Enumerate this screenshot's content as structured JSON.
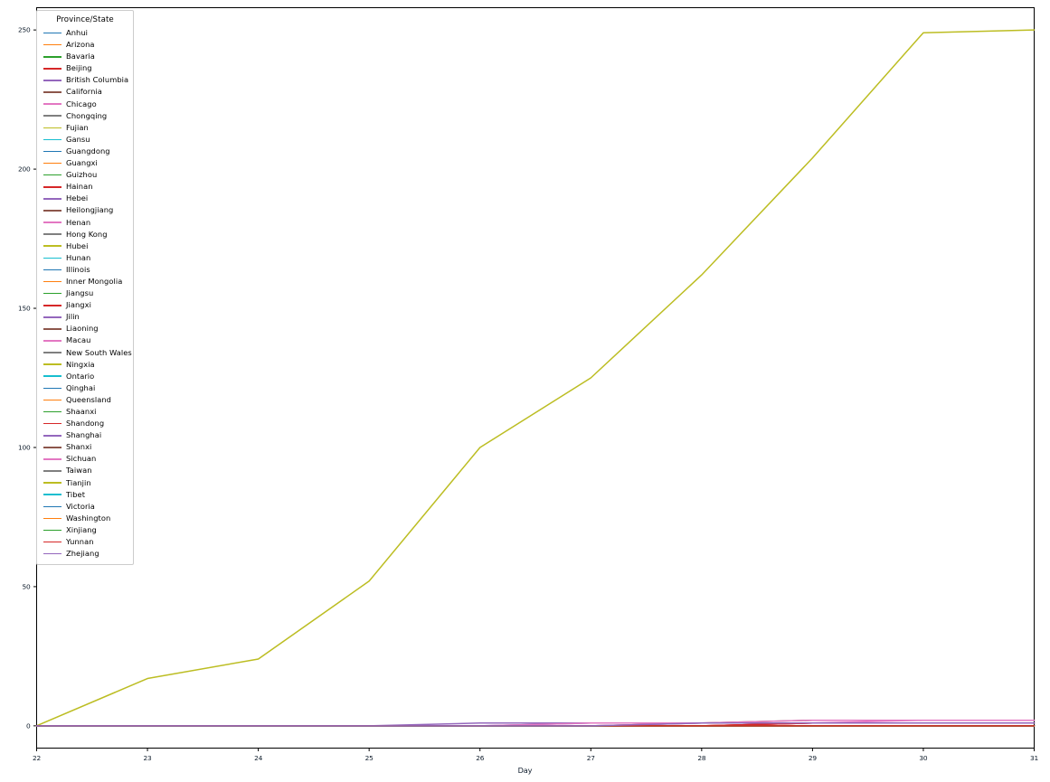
{
  "chart_data": {
    "type": "line",
    "title": "",
    "xlabel": "Day",
    "ylabel": "",
    "legend_title": "Province/State",
    "legend_position": "upper-left-inside",
    "grid": false,
    "x": [
      22,
      23,
      24,
      25,
      26,
      27,
      28,
      29,
      30,
      31
    ],
    "xticks": [
      "22",
      "23",
      "24",
      "25",
      "26",
      "27",
      "28",
      "29",
      "30",
      "31"
    ],
    "yticks": [
      "0",
      "50",
      "100",
      "150",
      "200",
      "250"
    ],
    "xlim": [
      22,
      31
    ],
    "ylim": [
      -8,
      258
    ],
    "series": [
      {
        "name": "Anhui",
        "color": "#1f77b4",
        "values": [
          0,
          0,
          0,
          0,
          0,
          0,
          0,
          0,
          0,
          0
        ]
      },
      {
        "name": "Arizona",
        "color": "#ff7f0e",
        "values": [
          0,
          0,
          0,
          0,
          0,
          0,
          0,
          0,
          0,
          0
        ]
      },
      {
        "name": "Bavaria",
        "color": "#2ca02c",
        "values": [
          0,
          0,
          0,
          0,
          0,
          0,
          0,
          0,
          0,
          0
        ]
      },
      {
        "name": "Beijing",
        "color": "#d62728",
        "values": [
          0,
          0,
          0,
          0,
          0,
          0,
          0,
          1,
          1,
          1
        ]
      },
      {
        "name": "British Columbia",
        "color": "#9467bd",
        "values": [
          0,
          0,
          0,
          0,
          0,
          0,
          0,
          0,
          0,
          0
        ]
      },
      {
        "name": "California",
        "color": "#8c564b",
        "values": [
          0,
          0,
          0,
          0,
          0,
          0,
          0,
          0,
          0,
          0
        ]
      },
      {
        "name": "Chicago",
        "color": "#e377c2",
        "values": [
          0,
          0,
          0,
          0,
          0,
          0,
          0,
          0,
          0,
          0
        ]
      },
      {
        "name": "Chongqing",
        "color": "#7f7f7f",
        "values": [
          0,
          0,
          0,
          0,
          0,
          0,
          0,
          0,
          0,
          0
        ]
      },
      {
        "name": "Fujian",
        "color": "#bcbd22",
        "values": [
          0,
          0,
          0,
          0,
          0,
          0,
          0,
          0,
          0,
          0
        ]
      },
      {
        "name": "Gansu",
        "color": "#17becf",
        "values": [
          0,
          0,
          0,
          0,
          0,
          0,
          0,
          0,
          0,
          0
        ]
      },
      {
        "name": "Guangdong",
        "color": "#1f77b4",
        "values": [
          0,
          0,
          0,
          0,
          0,
          0,
          0,
          0,
          0,
          0
        ]
      },
      {
        "name": "Guangxi",
        "color": "#ff7f0e",
        "values": [
          0,
          0,
          0,
          0,
          0,
          0,
          0,
          0,
          0,
          0
        ]
      },
      {
        "name": "Guizhou",
        "color": "#2ca02c",
        "values": [
          0,
          0,
          0,
          0,
          0,
          0,
          0,
          0,
          0,
          0
        ]
      },
      {
        "name": "Hainan",
        "color": "#d62728",
        "values": [
          0,
          0,
          0,
          0,
          0,
          0,
          0,
          1,
          1,
          1
        ]
      },
      {
        "name": "Hebei",
        "color": "#9467bd",
        "values": [
          0,
          0,
          0,
          0,
          0,
          1,
          1,
          1,
          1,
          1
        ]
      },
      {
        "name": "Heilongjiang",
        "color": "#8c564b",
        "values": [
          0,
          0,
          0,
          0,
          0,
          0,
          1,
          2,
          2,
          2
        ]
      },
      {
        "name": "Henan",
        "color": "#e377c2",
        "values": [
          0,
          0,
          0,
          0,
          0,
          0,
          1,
          2,
          2,
          2
        ]
      },
      {
        "name": "Hong Kong",
        "color": "#7f7f7f",
        "values": [
          0,
          0,
          0,
          0,
          0,
          0,
          0,
          0,
          0,
          0
        ]
      },
      {
        "name": "Hubei",
        "color": "#bcbd22",
        "values": [
          0,
          17,
          24,
          52,
          100,
          125,
          162,
          204,
          249,
          250
        ]
      },
      {
        "name": "Hunan",
        "color": "#17becf",
        "values": [
          0,
          0,
          0,
          0,
          0,
          0,
          0,
          0,
          0,
          0
        ]
      },
      {
        "name": "Illinois",
        "color": "#1f77b4",
        "values": [
          0,
          0,
          0,
          0,
          0,
          0,
          0,
          0,
          0,
          0
        ]
      },
      {
        "name": "Inner Mongolia",
        "color": "#ff7f0e",
        "values": [
          0,
          0,
          0,
          0,
          0,
          0,
          0,
          0,
          0,
          0
        ]
      },
      {
        "name": "Jiangsu",
        "color": "#2ca02c",
        "values": [
          0,
          0,
          0,
          0,
          0,
          0,
          0,
          0,
          0,
          0
        ]
      },
      {
        "name": "Jiangxi",
        "color": "#d62728",
        "values": [
          0,
          0,
          0,
          0,
          0,
          0,
          0,
          0,
          0,
          0
        ]
      },
      {
        "name": "Jilin",
        "color": "#9467bd",
        "values": [
          0,
          0,
          0,
          0,
          0,
          0,
          0,
          0,
          0,
          0
        ]
      },
      {
        "name": "Liaoning",
        "color": "#8c564b",
        "values": [
          0,
          0,
          0,
          0,
          0,
          0,
          0,
          0,
          0,
          0
        ]
      },
      {
        "name": "Macau",
        "color": "#e377c2",
        "values": [
          0,
          0,
          0,
          0,
          0,
          0,
          0,
          0,
          0,
          0
        ]
      },
      {
        "name": "New South Wales",
        "color": "#7f7f7f",
        "values": [
          0,
          0,
          0,
          0,
          0,
          0,
          0,
          0,
          0,
          0
        ]
      },
      {
        "name": "Ningxia",
        "color": "#bcbd22",
        "values": [
          0,
          0,
          0,
          0,
          0,
          0,
          0,
          0,
          0,
          0
        ]
      },
      {
        "name": "Ontario",
        "color": "#17becf",
        "values": [
          0,
          0,
          0,
          0,
          0,
          0,
          0,
          0,
          0,
          0
        ]
      },
      {
        "name": "Qinghai",
        "color": "#1f77b4",
        "values": [
          0,
          0,
          0,
          0,
          0,
          0,
          0,
          0,
          0,
          0
        ]
      },
      {
        "name": "Queensland",
        "color": "#ff7f0e",
        "values": [
          0,
          0,
          0,
          0,
          0,
          0,
          0,
          0,
          0,
          0
        ]
      },
      {
        "name": "Shaanxi",
        "color": "#2ca02c",
        "values": [
          0,
          0,
          0,
          0,
          0,
          0,
          0,
          0,
          0,
          0
        ]
      },
      {
        "name": "Shandong",
        "color": "#d62728",
        "values": [
          0,
          0,
          0,
          0,
          0,
          0,
          0,
          1,
          1,
          1
        ]
      },
      {
        "name": "Shanghai",
        "color": "#9467bd",
        "values": [
          0,
          0,
          0,
          0,
          1,
          1,
          1,
          1,
          1,
          1
        ]
      },
      {
        "name": "Shanxi",
        "color": "#8c564b",
        "values": [
          0,
          0,
          0,
          0,
          0,
          0,
          0,
          0,
          0,
          0
        ]
      },
      {
        "name": "Sichuan",
        "color": "#e377c2",
        "values": [
          0,
          0,
          0,
          0,
          0,
          1,
          1,
          1,
          2,
          2
        ]
      },
      {
        "name": "Taiwan",
        "color": "#7f7f7f",
        "values": [
          0,
          0,
          0,
          0,
          0,
          0,
          0,
          0,
          0,
          0
        ]
      },
      {
        "name": "Tianjin",
        "color": "#bcbd22",
        "values": [
          0,
          0,
          0,
          0,
          0,
          0,
          0,
          0,
          0,
          0
        ]
      },
      {
        "name": "Tibet",
        "color": "#17becf",
        "values": [
          0,
          0,
          0,
          0,
          0,
          0,
          0,
          0,
          0,
          0
        ]
      },
      {
        "name": "Victoria",
        "color": "#1f77b4",
        "values": [
          0,
          0,
          0,
          0,
          0,
          0,
          0,
          0,
          0,
          0
        ]
      },
      {
        "name": "Washington",
        "color": "#ff7f0e",
        "values": [
          0,
          0,
          0,
          0,
          0,
          0,
          0,
          0,
          0,
          0
        ]
      },
      {
        "name": "Xinjiang",
        "color": "#2ca02c",
        "values": [
          0,
          0,
          0,
          0,
          0,
          0,
          0,
          0,
          0,
          0
        ]
      },
      {
        "name": "Yunnan",
        "color": "#d62728",
        "values": [
          0,
          0,
          0,
          0,
          0,
          0,
          0,
          0,
          0,
          0
        ]
      },
      {
        "name": "Zhejiang",
        "color": "#9467bd",
        "values": [
          0,
          0,
          0,
          0,
          0,
          0,
          1,
          1,
          1,
          1
        ]
      }
    ]
  }
}
